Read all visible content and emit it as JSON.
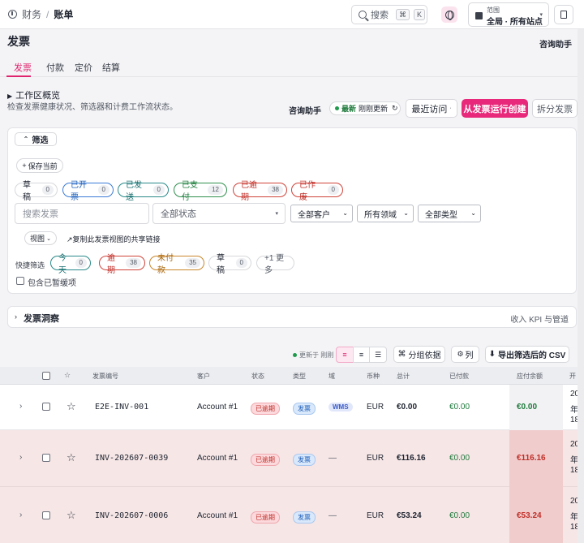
{
  "breadcrumb": {
    "section": "财务",
    "separator": "/",
    "current": "账单"
  },
  "search": {
    "label": "搜索",
    "key1": "⌘",
    "key2": "K"
  },
  "scope": {
    "label": "范围",
    "value": "全局 · 所有站点"
  },
  "page": {
    "title": "发票",
    "consult": "咨询助手"
  },
  "tabs": [
    "发票",
    "付款",
    "定价",
    "结算"
  ],
  "workspace": {
    "title": "工作区概览",
    "subtitle": "检查发票健康状况、筛选器和计费工作流状态。",
    "consult": "咨询助手",
    "latest_label": "最新",
    "latest_status": "刚刚更新",
    "recent_label": "最近访问",
    "run_create": "从发票运行创建",
    "split_invoice": "拆分发票"
  },
  "filter": {
    "header": "筛选",
    "save_current": "保存当前",
    "status_pills": [
      {
        "label": "草稿",
        "count": "0"
      },
      {
        "label": "已开票",
        "count": "0"
      },
      {
        "label": "已发送",
        "count": "0"
      },
      {
        "label": "已支付",
        "count": "12"
      },
      {
        "label": "已逾期",
        "count": "38"
      },
      {
        "label": "已作废",
        "count": "0"
      }
    ],
    "search_placeholder": "搜索发票",
    "all_status": "全部状态",
    "all_customers": "全部客户",
    "all_domains": "所有领域",
    "all_types": "全部类型",
    "view_label": "视图",
    "share_link": "复制此发票视图的共享链接",
    "quick_label": "快捷筛选",
    "quick_pills": [
      {
        "label": "今天",
        "count": "0"
      },
      {
        "label": "逾期",
        "count": "38"
      },
      {
        "label": "未付款",
        "count": "35"
      },
      {
        "label": "草稿",
        "count": "0"
      }
    ],
    "more": "+1 更多",
    "include_archived": "包含已暂缓项"
  },
  "insights": {
    "title": "发票洞察",
    "right": "收入 KPI 与管道"
  },
  "toolbar": {
    "updated": "更新于 刚刚",
    "group_by": "分组依据",
    "columns": "列",
    "export_csv": "导出筛选后的 CSV"
  },
  "table": {
    "columns": [
      "发票编号",
      "客户",
      "状态",
      "类型",
      "域",
      "币种",
      "总计",
      "已付款",
      "应付余额",
      "开"
    ],
    "rows": [
      {
        "id": "E2E-INV-001",
        "customer": "Account #1",
        "status": "已逾期",
        "type": "发票",
        "domain": "WMS",
        "currency": "EUR",
        "total": "€0.00",
        "paid": "€0.00",
        "balance": "€0.00",
        "open": [
          "20",
          "年",
          "18"
        ]
      },
      {
        "id": "INV-202607-0039",
        "customer": "Account #1",
        "status": "已逾期",
        "type": "发票",
        "domain": "—",
        "currency": "EUR",
        "total": "€116.16",
        "paid": "€0.00",
        "balance": "€116.16",
        "open": [
          "20",
          "年",
          "18"
        ]
      },
      {
        "id": "INV-202607-0006",
        "customer": "Account #1",
        "status": "已逾期",
        "type": "发票",
        "domain": "—",
        "currency": "EUR",
        "total": "€53.24",
        "paid": "€0.00",
        "balance": "€53.24",
        "open": [
          "20",
          "年",
          "18"
        ]
      }
    ]
  },
  "colors": {
    "accent": "#e8287a",
    "overdue_row": "#f6e6e6",
    "balance_cell": "#f0cccc",
    "paid_green": "#1f7a3c",
    "balance_red": "#c0302a"
  }
}
